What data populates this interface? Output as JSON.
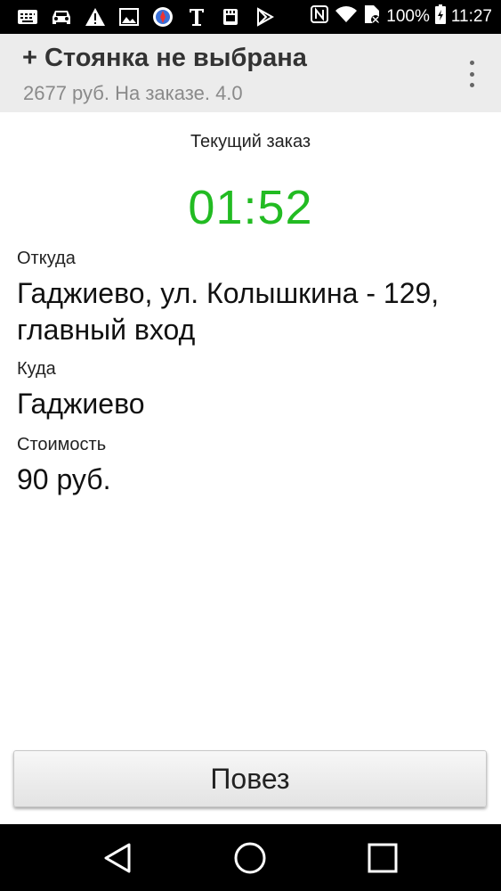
{
  "status_bar": {
    "battery": "100%",
    "time": "11:27",
    "icons": [
      "mail-icon",
      "taxi-icon",
      "warning-icon",
      "image-icon",
      "compass-icon",
      "font-t-icon",
      "storage-icon",
      "play-store-icon",
      "nfc-icon",
      "wifi-icon",
      "no-sim-icon",
      "battery-icon"
    ]
  },
  "header": {
    "title": "+ Стоянка не выбрана",
    "subtitle": "2677 руб. На заказе. 4.0",
    "menu_icon": "overflow-menu-icon"
  },
  "order": {
    "section_label": "Текущий заказ",
    "timer": "01:52",
    "timer_color": "#22bb22",
    "from_label": "Откуда",
    "from_value": "Гаджиево, ул. Колышкина - 129, главный вход",
    "to_label": "Куда",
    "to_value": "Гаджиево",
    "cost_label": "Стоимость",
    "cost_value": "90 руб."
  },
  "action": {
    "button_label": "Повез"
  },
  "nav": {
    "icons": [
      "back-icon",
      "home-icon",
      "recents-icon"
    ]
  }
}
